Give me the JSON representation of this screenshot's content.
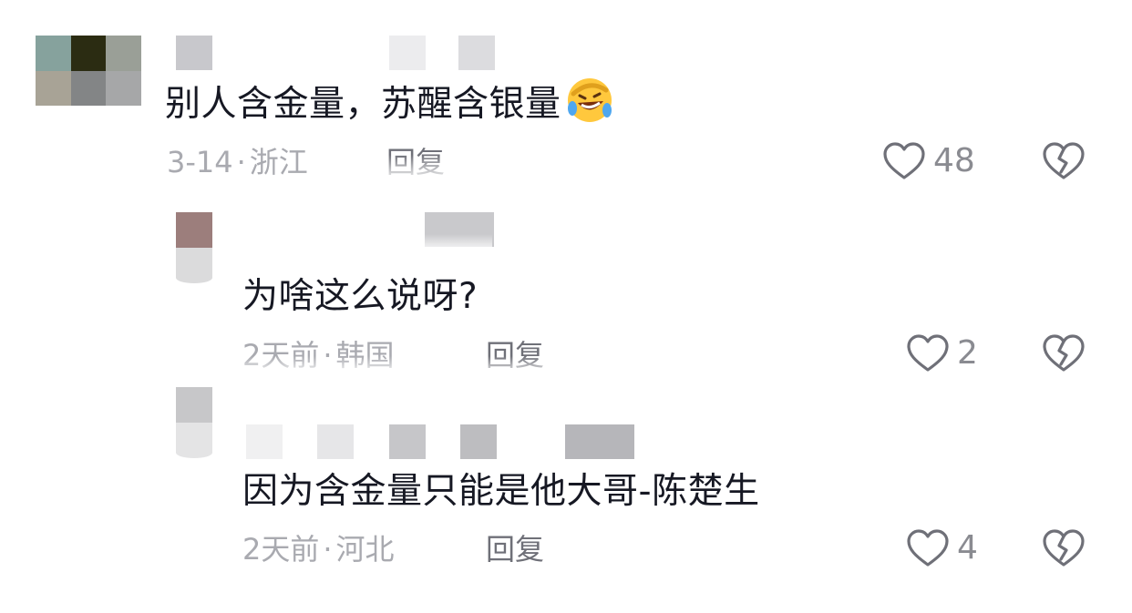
{
  "colors": {
    "text_primary": "#161823",
    "text_meta": "#a9aab0",
    "reply_button": "#6f7078",
    "icon_stroke": "#6f7078",
    "like_count": "#8a8b91"
  },
  "comments": [
    {
      "text": "别人含金量，苏醒含银量",
      "emoji": "rofl-emoji",
      "date": "3-14",
      "separator": "·",
      "location": "浙江",
      "reply_label": "回复",
      "likes": "48",
      "like_icon": "heart-outline-icon",
      "dislike_icon": "broken-heart-icon"
    },
    {
      "text": "为啥这么说呀?",
      "date": "2天前",
      "separator": "·",
      "location": "韩国",
      "reply_label": "回复",
      "likes": "2",
      "like_icon": "heart-outline-icon",
      "dislike_icon": "broken-heart-icon"
    },
    {
      "text": "因为含金量只能是他大哥-陈楚生",
      "date": "2天前",
      "separator": "·",
      "location": "河北",
      "reply_label": "回复",
      "likes": "4",
      "like_icon": "heart-outline-icon",
      "dislike_icon": "broken-heart-icon"
    }
  ]
}
